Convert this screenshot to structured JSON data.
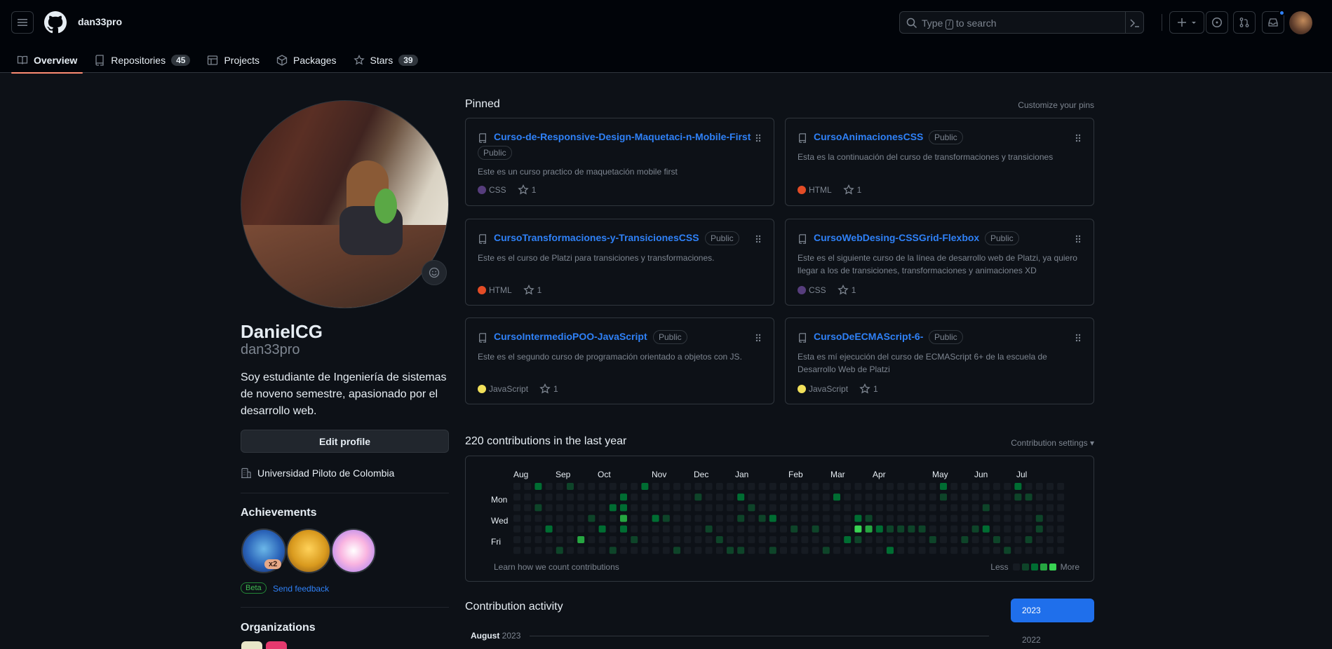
{
  "header": {
    "username": "dan33pro",
    "search_prefix": "Type",
    "search_key": "/",
    "search_suffix": "to search"
  },
  "tabs": [
    {
      "label": "Overview",
      "count": ""
    },
    {
      "label": "Repositories",
      "count": "45"
    },
    {
      "label": "Projects",
      "count": ""
    },
    {
      "label": "Packages",
      "count": ""
    },
    {
      "label": "Stars",
      "count": "39"
    }
  ],
  "profile": {
    "name": "DanielCG",
    "login": "dan33pro",
    "bio": "Soy estudiante de Ingeniería de sistemas de noveno semestre, apasionado por el desarrollo web.",
    "edit_label": "Edit profile",
    "organization": "Universidad Piloto de Colombia"
  },
  "achievements": {
    "title": "Achievements",
    "multiplier": "x2",
    "beta_label": "Beta",
    "feedback_label": "Send feedback"
  },
  "organizations": {
    "title": "Organizations"
  },
  "pinned": {
    "title": "Pinned",
    "customize_label": "Customize your pins",
    "public_label": "Public",
    "cards": [
      {
        "name": "Curso-de-Responsive-Design-Maquetaci-n-Mobile-First",
        "desc": "Este es un curso practico de maquetación mobile first",
        "lang": "CSS",
        "color": "#563d7c",
        "stars": "1"
      },
      {
        "name": "CursoAnimacionesCSS",
        "desc": "Esta es la continuación del curso de transformaciones y transiciones",
        "lang": "HTML",
        "color": "#e34c26",
        "stars": "1"
      },
      {
        "name": "CursoTransformaciones-y-TransicionesCSS",
        "desc": "Este es el curso de Platzi para transiciones y transformaciones.",
        "lang": "HTML",
        "color": "#e34c26",
        "stars": "1"
      },
      {
        "name": "CursoWebDesing-CSSGrid-Flexbox",
        "desc": "Este es el siguiente curso de la línea de desarrollo web de Platzi, ya quiero llegar a los de transiciones, transformaciones y animaciones XD",
        "lang": "CSS",
        "color": "#563d7c",
        "stars": "1"
      },
      {
        "name": "CursoIntermedioPOO-JavaScript",
        "desc": "Este es el segundo curso de programación orientado a objetos con JS.",
        "lang": "JavaScript",
        "color": "#f1e05a",
        "stars": "1"
      },
      {
        "name": "CursoDeECMAScript-6-",
        "desc": "Esta es mí ejecución del curso de ECMAScript 6+ de la escuela de Desarrollo Web de Platzi",
        "lang": "JavaScript",
        "color": "#f1e05a",
        "stars": "1"
      }
    ]
  },
  "contributions": {
    "title": "220 contributions in the last year",
    "settings_label": "Contribution settings",
    "months": [
      "Aug",
      "Sep",
      "Oct",
      "Nov",
      "Dec",
      "Jan",
      "Feb",
      "Mar",
      "Apr",
      "May",
      "Jun",
      "Jul"
    ],
    "days": [
      "Mon",
      "Wed",
      "Fri"
    ],
    "learn_label": "Learn how we count contributions",
    "less_label": "Less",
    "more_label": "More",
    "colors": [
      "#161b22",
      "#0e4429",
      "#006d32",
      "#26a641",
      "#39d353"
    ]
  },
  "activity": {
    "title": "Contribution activity",
    "years": [
      "2023",
      "2022"
    ],
    "month_name": "August",
    "month_year": "2023"
  }
}
